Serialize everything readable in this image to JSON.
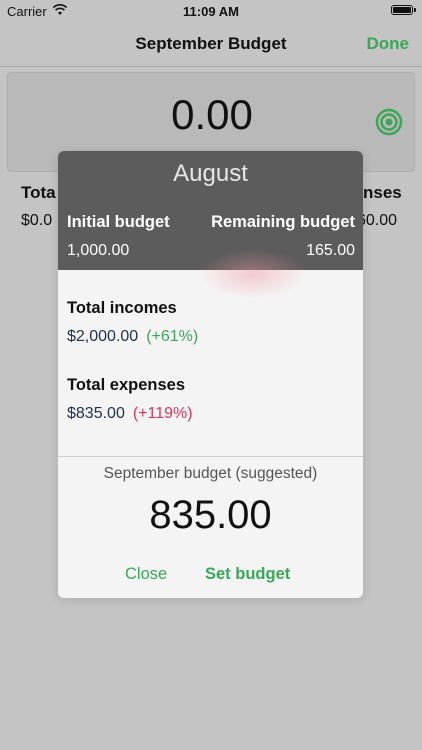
{
  "status_bar": {
    "carrier": "Carrier",
    "time": "11:09 AM"
  },
  "nav": {
    "title": "September Budget",
    "done_label": "Done"
  },
  "background": {
    "amount": "0.00",
    "left_label_partial": "Tota",
    "left_value_partial": "$0.0",
    "right_label_partial": "nses",
    "right_value_partial": "60.00"
  },
  "modal": {
    "month": "August",
    "initial_budget_label": "Initial budget",
    "initial_budget_value": "1,000.00",
    "remaining_budget_label": "Remaining budget",
    "remaining_budget_value": "165.00",
    "total_incomes_label": "Total incomes",
    "total_incomes_value": "$2,000.00",
    "total_incomes_pct": "(+61%)",
    "total_expenses_label": "Total expenses",
    "total_expenses_value": "$835.00",
    "total_expenses_pct": "(+119%)",
    "suggested_label": "September budget (suggested)",
    "suggested_value": "835.00",
    "close_label": "Close",
    "set_budget_label": "Set budget"
  },
  "colors": {
    "accent_green": "#3aa757",
    "negative_red": "#d8355d",
    "modal_header": "#5c5c5c",
    "dim_background": "#c4c4c4"
  },
  "icons": {
    "wifi": "wifi-icon",
    "battery": "battery-icon",
    "target": "target-icon"
  }
}
